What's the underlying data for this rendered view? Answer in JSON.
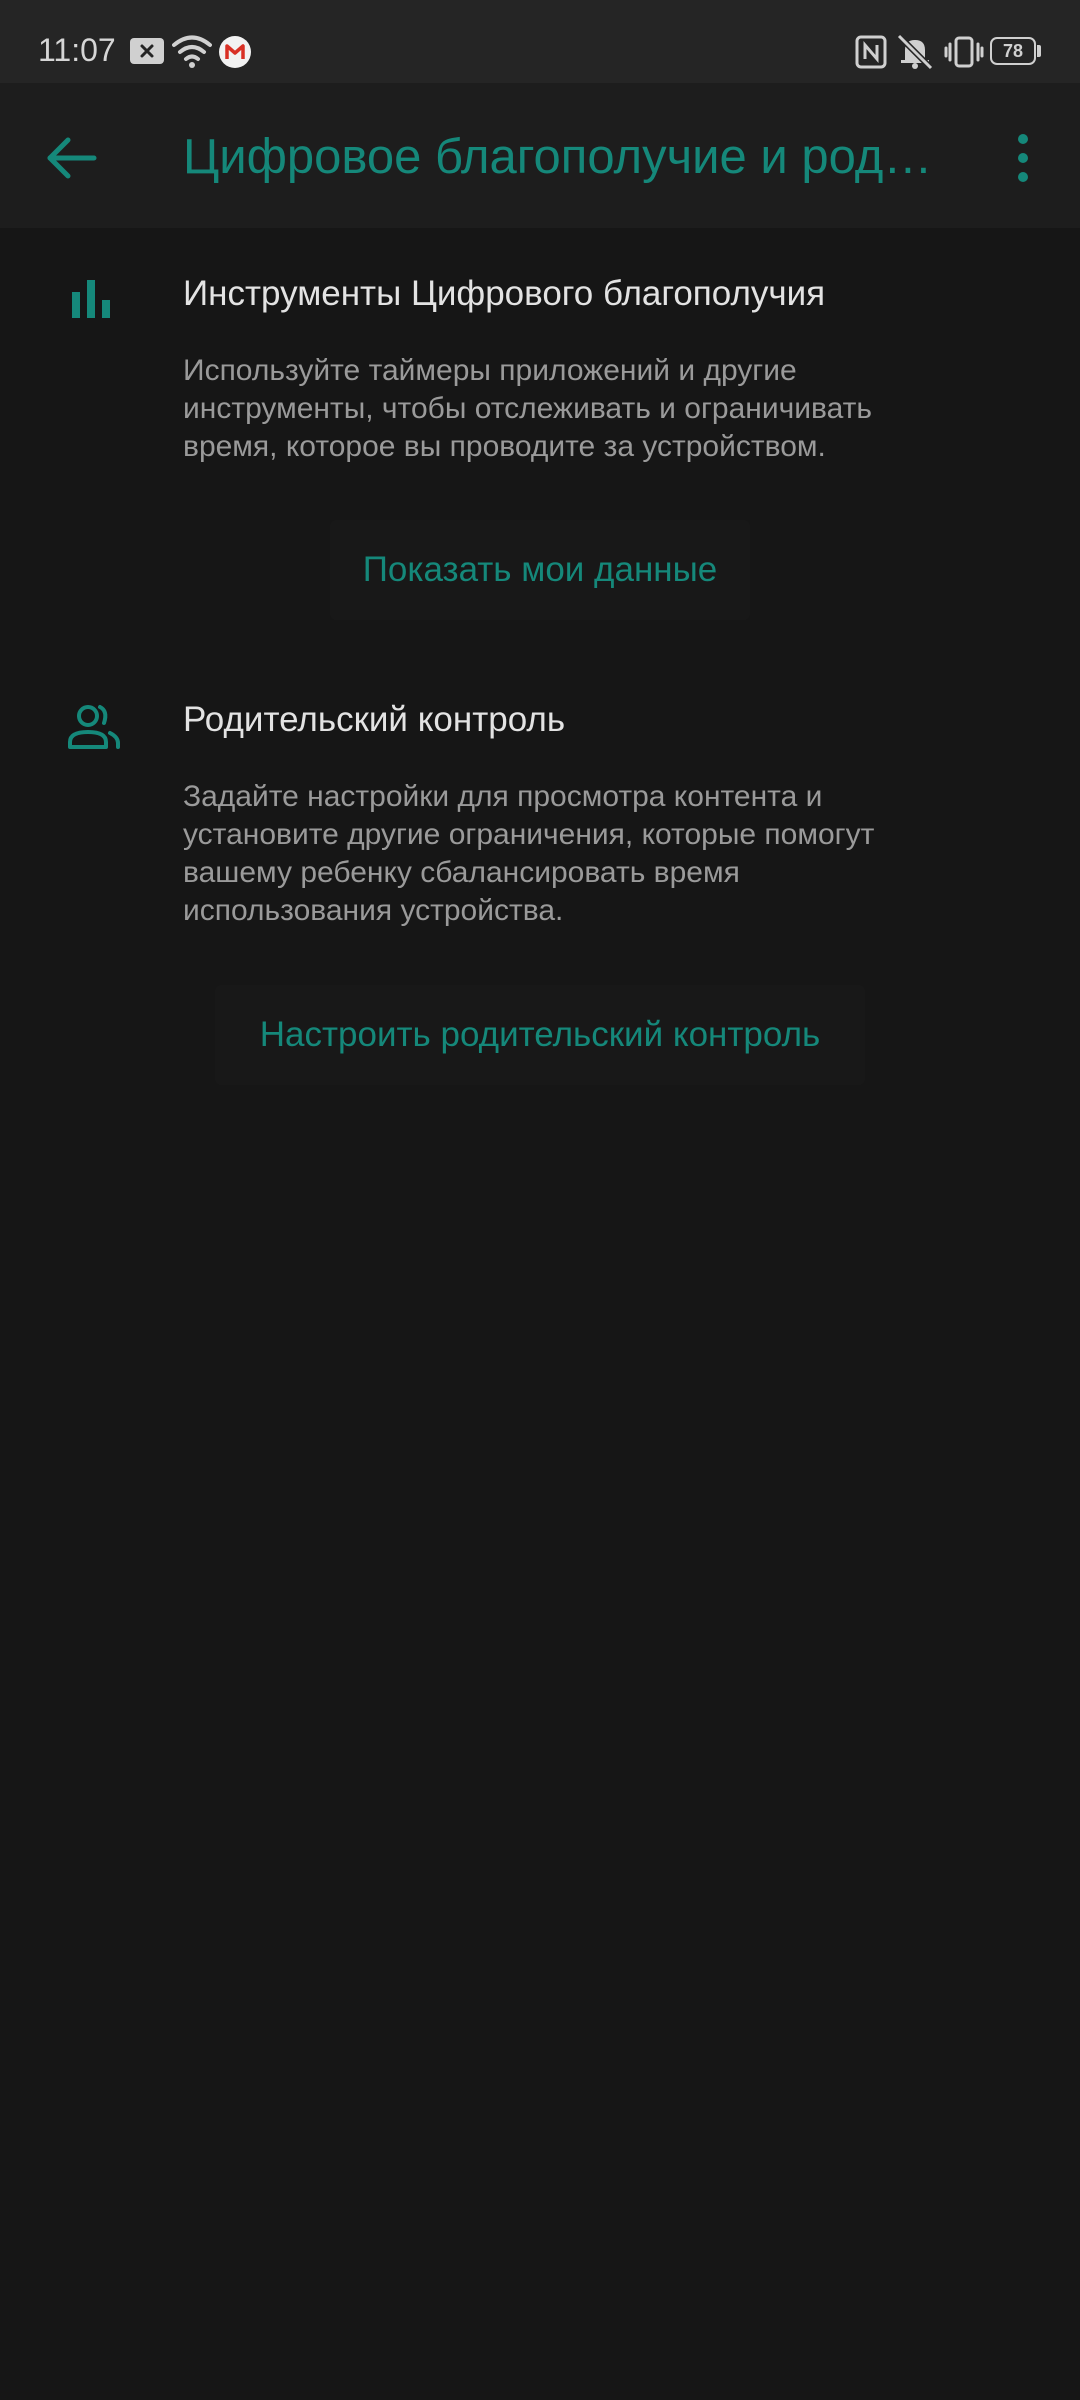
{
  "status_bar": {
    "time": "11:07",
    "battery": "78",
    "icons": [
      "close-box-icon",
      "wifi-icon",
      "gmail-icon",
      "nfc-icon",
      "mute-icon",
      "vibrate-icon",
      "battery-icon"
    ]
  },
  "app_bar": {
    "title": "Цифровое благополучие и родительский контроль",
    "back_icon": "arrow-back-icon",
    "more_icon": "more-vert-icon"
  },
  "sections": [
    {
      "icon": "bar-chart-icon",
      "title": "Инструменты Цифрового благополучия",
      "description": "Используйте таймеры приложений и другие инструменты, чтобы отслеживать и ограничивать время, которое вы проводите за устройством.",
      "button": "Показать мои данные"
    },
    {
      "icon": "people-icon",
      "title": "Родительский контроль",
      "description": "Задайте настройки для просмотра контента и установите другие ограничения, которые помогут вашему ребенку сбалансировать время использования устройства.",
      "button": "Настроить родительский контроль"
    }
  ],
  "colors": {
    "accent": "#15887a",
    "background": "#161616",
    "app_bar": "#1d1d1d",
    "status_bar": "#252525",
    "title_text": "#e3e3e3",
    "secondary_text": "#9a9a9a"
  }
}
